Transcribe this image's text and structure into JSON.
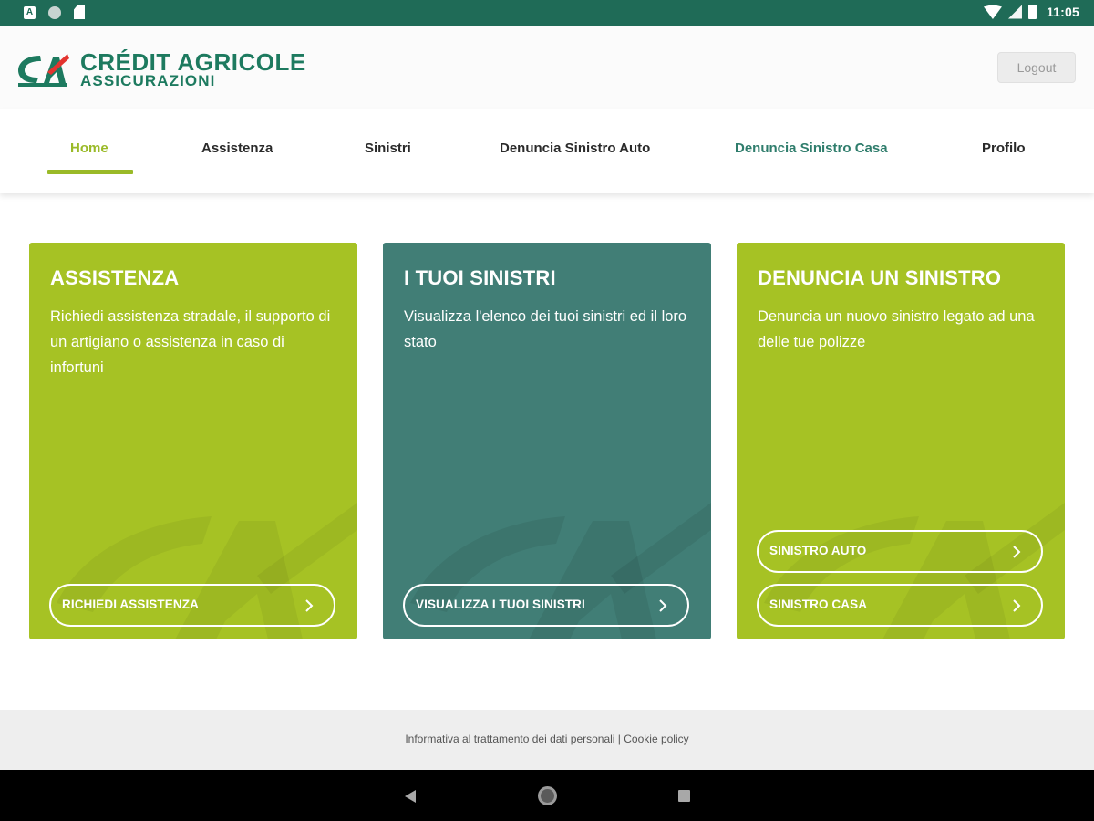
{
  "status_bar": {
    "time": "11:05",
    "icons": [
      "accessibility-a-icon",
      "sync-circle-icon",
      "sd-card-icon",
      "wifi-icon",
      "signal-icon",
      "battery-icon"
    ]
  },
  "header": {
    "brand_line1": "CRÉDIT AGRICOLE",
    "brand_line2": "ASSICURAZIONI",
    "logout_label": "Logout"
  },
  "nav": {
    "items": [
      {
        "label": "Home",
        "active": true
      },
      {
        "label": "Assistenza"
      },
      {
        "label": "Sinistri"
      },
      {
        "label": "Denuncia Sinistro Auto"
      },
      {
        "label": "Denuncia Sinistro Casa"
      },
      {
        "label": "Profilo"
      }
    ]
  },
  "cards": [
    {
      "title": "ASSISTENZA",
      "description": "Richiedi assistenza stradale, il supporto di un artigiano o assistenza in caso di infortuni",
      "buttons": [
        {
          "label": "RICHIEDI ASSISTENZA"
        }
      ]
    },
    {
      "title": "I TUOI SINISTRI",
      "description": "Visualizza l'elenco dei tuoi sinistri ed il loro stato",
      "buttons": [
        {
          "label": "VISUALIZZA I TUOI SINISTRI"
        }
      ]
    },
    {
      "title": "DENUNCIA UN SINISTRO",
      "description": "Denuncia un nuovo sinistro legato ad una delle tue polizze",
      "buttons": [
        {
          "label": "SINISTRO AUTO"
        },
        {
          "label": "SINISTRO CASA"
        }
      ]
    }
  ],
  "footer": {
    "privacy_link": "Informativa al trattamento dei dati personali",
    "separator": " | ",
    "cookie_link": "Cookie policy"
  },
  "colors": {
    "brand_green": "#1d7a5f",
    "card_green": "#a6c224",
    "card_teal": "#417e76",
    "active_nav": "#9aba28",
    "status_bar": "#1f6b57"
  }
}
